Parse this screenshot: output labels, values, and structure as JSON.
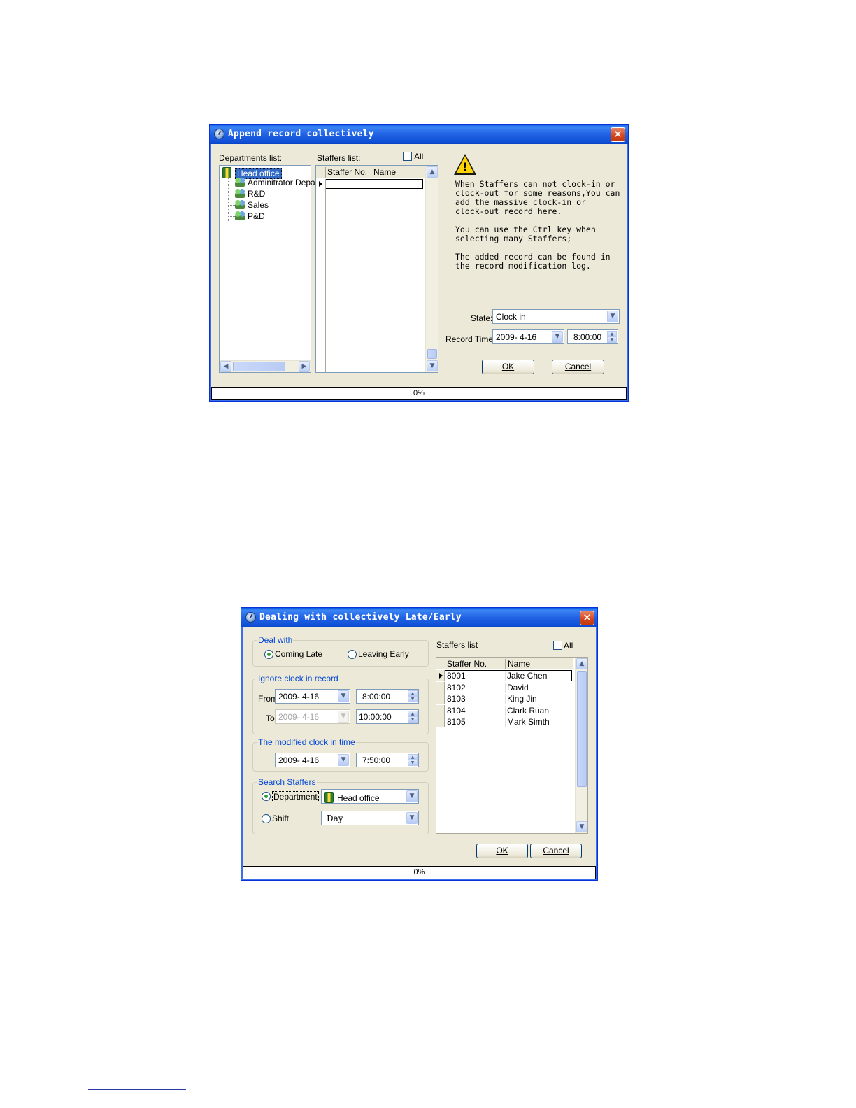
{
  "dialog1": {
    "title": "Append record collectively",
    "close_icon": "close-icon",
    "departments_label": "Departments list:",
    "departments": {
      "root": "Head office",
      "children": [
        "Adminitrator Depar",
        "R&D",
        "Sales",
        "P&D"
      ]
    },
    "staffers_label": "Staffers list:",
    "all_label": "All",
    "grid_columns": [
      "Staffer No.",
      "Name"
    ],
    "info_text": "When Staffers can not clock-in or\nclock-out for some reasons,You can\nadd the massive clock-in or\nclock-out record here.\n\nYou can use the Ctrl key when\nselecting many Staffers;\n\nThe added record can be found in\nthe record modification log.",
    "state_label": "State:",
    "state_value": "Clock in",
    "record_time_label": "Record Time:",
    "record_date": "2009- 4-16",
    "record_time": "8:00:00",
    "ok_label": "OK",
    "cancel_label": "Cancel",
    "progress": "0%"
  },
  "dialog2": {
    "title": "Dealing with collectively Late/Early",
    "deal_with_title": "Deal with",
    "coming_late": "Coming Late",
    "leaving_early": "Leaving Early",
    "ignore_title": "Ignore clock in record",
    "from_label": "From",
    "from_date": "2009- 4-16",
    "from_time": "8:00:00",
    "to_label": "To",
    "to_date": "2009- 4-16",
    "to_time": "10:00:00",
    "modified_title": "The modified clock in time",
    "modified_date": "2009- 4-16",
    "modified_time": "7:50:00",
    "search_title": "Search Staffers",
    "department_label": "Department",
    "department_value": "Head office",
    "shift_label": "Shift",
    "shift_value": "Day",
    "staffers_label": "Staffers list",
    "all_label": "All",
    "grid_columns": [
      "Staffer No.",
      "Name"
    ],
    "rows": [
      {
        "no": "8001",
        "name": "Jake Chen"
      },
      {
        "no": "8102",
        "name": "David"
      },
      {
        "no": "8103",
        "name": "King Jin"
      },
      {
        "no": "8104",
        "name": "Clark Ruan"
      },
      {
        "no": "8105",
        "name": "Mark Simth"
      }
    ],
    "ok_label": "OK",
    "cancel_label": "Cancel",
    "progress": "0%"
  }
}
